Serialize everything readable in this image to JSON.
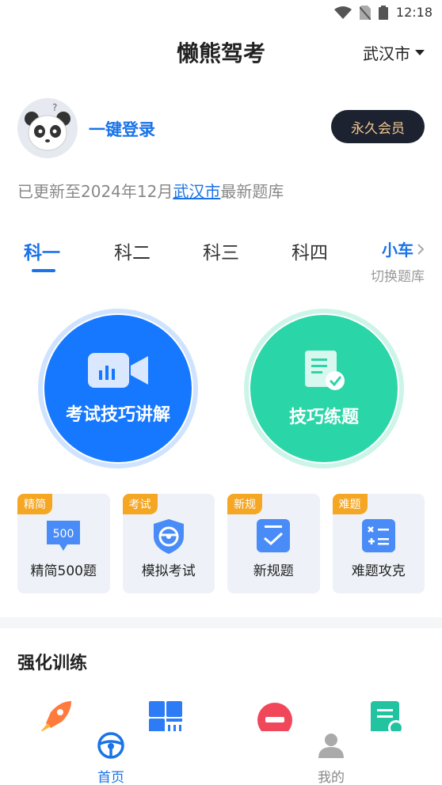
{
  "status_bar": {
    "time": "12:18"
  },
  "header": {
    "title": "懒熊驾考",
    "city": "武汉市"
  },
  "profile": {
    "login_label": "一键登录",
    "vip_label": "永久会员"
  },
  "update_info": {
    "prefix": "已更新至2024年12月",
    "city": "武汉市",
    "suffix": "最新题库"
  },
  "subjects": {
    "tabs": [
      "科一",
      "科二",
      "科三",
      "科四"
    ],
    "active_index": 0,
    "car_type": "小车",
    "switch_label": "切换题库"
  },
  "main_buttons": {
    "video": {
      "label": "考试技巧讲解",
      "color": "#1677ff"
    },
    "practice": {
      "label": "技巧练题",
      "color": "#2ad6a7"
    }
  },
  "cards": [
    {
      "tag": "精简",
      "label": "精简500题",
      "icon": "500-icon",
      "icon_text": "500"
    },
    {
      "tag": "考试",
      "label": "模拟考试",
      "icon": "steering-shield-icon"
    },
    {
      "tag": "新规",
      "label": "新规题",
      "icon": "checklist-icon"
    },
    {
      "tag": "难题",
      "label": "难题攻克",
      "icon": "calculator-icon"
    }
  ],
  "section": {
    "title": "强化训练"
  },
  "training_icons": [
    "rocket-icon",
    "grid-icon",
    "minus-circle-icon",
    "list-check-icon"
  ],
  "bottom_nav": {
    "home": {
      "label": "首页",
      "icon": "steering-wheel-icon",
      "active": true
    },
    "mine": {
      "label": "我的",
      "icon": "user-icon",
      "active": false
    }
  },
  "colors": {
    "accent": "#1a73e8",
    "tag": "#f5a623",
    "vip_bg": "#1d2230",
    "vip_text": "#f0c890"
  }
}
